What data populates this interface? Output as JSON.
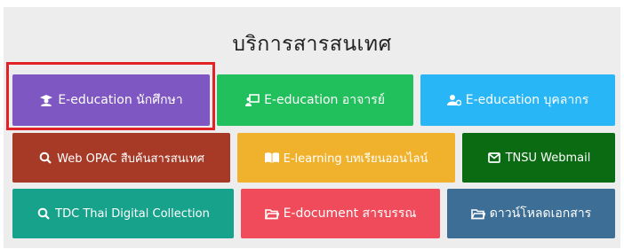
{
  "section": {
    "title": "บริการสารสนเทศ"
  },
  "buttons": {
    "student": {
      "label": "E-education นักศึกษา",
      "icon": "student-icon",
      "color": "#7e57c2"
    },
    "teacher": {
      "label": "E-education อาจารย์",
      "icon": "teacher-board-icon",
      "color": "#21c05c"
    },
    "staff": {
      "label": "E-education บุคลากร",
      "icon": "staff-gear-icon",
      "color": "#29b6f6"
    },
    "opac": {
      "label": "Web OPAC สืบค้นสารสนเทศ",
      "icon": "search-icon",
      "color": "#a63a26"
    },
    "elearning": {
      "label": "E-learning บทเรียนออนไลน์",
      "icon": "book-icon",
      "color": "#f0b22c"
    },
    "webmail": {
      "label": "TNSU Webmail",
      "icon": "envelope-icon",
      "color": "#0a6b12"
    },
    "tdc": {
      "label": "TDC Thai Digital Collection",
      "icon": "search-icon",
      "color": "#17a28b"
    },
    "edocument": {
      "label": "E-document สารบรรณ",
      "icon": "folder-icon",
      "color": "#ef4b5b"
    },
    "download": {
      "label": "ดาวน์โหลดเอกสาร",
      "icon": "folder-icon",
      "color": "#3d6e96"
    }
  },
  "highlight_color": "#e12227"
}
